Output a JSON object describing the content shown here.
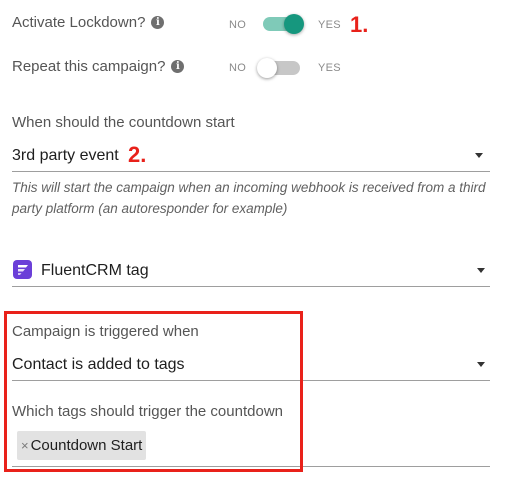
{
  "lockdown": {
    "label": "Activate Lockdown?",
    "no_label": "NO",
    "yes_label": "YES",
    "enabled": true,
    "annotation": "1."
  },
  "repeat": {
    "label": "Repeat this campaign?",
    "no_label": "NO",
    "yes_label": "YES",
    "enabled": false
  },
  "countdown_start": {
    "label": "When should the countdown start",
    "value": "3rd party event",
    "annotation": "2.",
    "hint": "This will start the campaign when an incoming webhook is received from a third party platform (an autoresponder for example)"
  },
  "integration": {
    "value": "FluentCRM tag",
    "icon": "fluentcrm-icon"
  },
  "trigger": {
    "label": "Campaign is triggered when",
    "value": "Contact is added to tags"
  },
  "tags": {
    "label": "Which tags should trigger the countdown",
    "chips": [
      {
        "label": "Countdown Start",
        "remove": "×"
      }
    ]
  },
  "colors": {
    "toggle_on": "#16977e",
    "annotation_red": "#e8211a",
    "fluent_purple": "#6b3fd8"
  }
}
